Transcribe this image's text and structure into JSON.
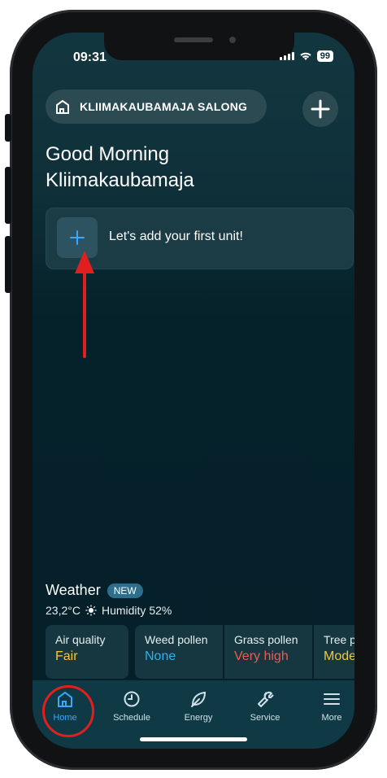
{
  "status": {
    "time": "09:31",
    "battery": "99"
  },
  "header": {
    "location": "KLIIMAKAUBAMAJA SALONG"
  },
  "greeting": {
    "line1": "Good Morning",
    "line2": "Kliimakaubamaja"
  },
  "add_unit": {
    "text": "Let's add your first unit!"
  },
  "weather": {
    "title": "Weather",
    "badge": "NEW",
    "temp": "23,2°C",
    "humidity": "Humidity 52%",
    "tiles": [
      {
        "label": "Air quality",
        "value": "Fair",
        "color": "#f5c53b"
      },
      {
        "label": "Weed pollen",
        "value": "None",
        "color": "#28b4f0"
      },
      {
        "label": "Grass pollen",
        "value": "Very high",
        "color": "#f05a4f"
      },
      {
        "label": "Tree po",
        "value": "Modera",
        "color": "#f5c53b"
      }
    ]
  },
  "nav": [
    {
      "label": "Home"
    },
    {
      "label": "Schedule"
    },
    {
      "label": "Energy"
    },
    {
      "label": "Service"
    },
    {
      "label": "More"
    }
  ],
  "colors": {
    "accent": "#39a7ff",
    "annotation": "#e11f1f"
  }
}
